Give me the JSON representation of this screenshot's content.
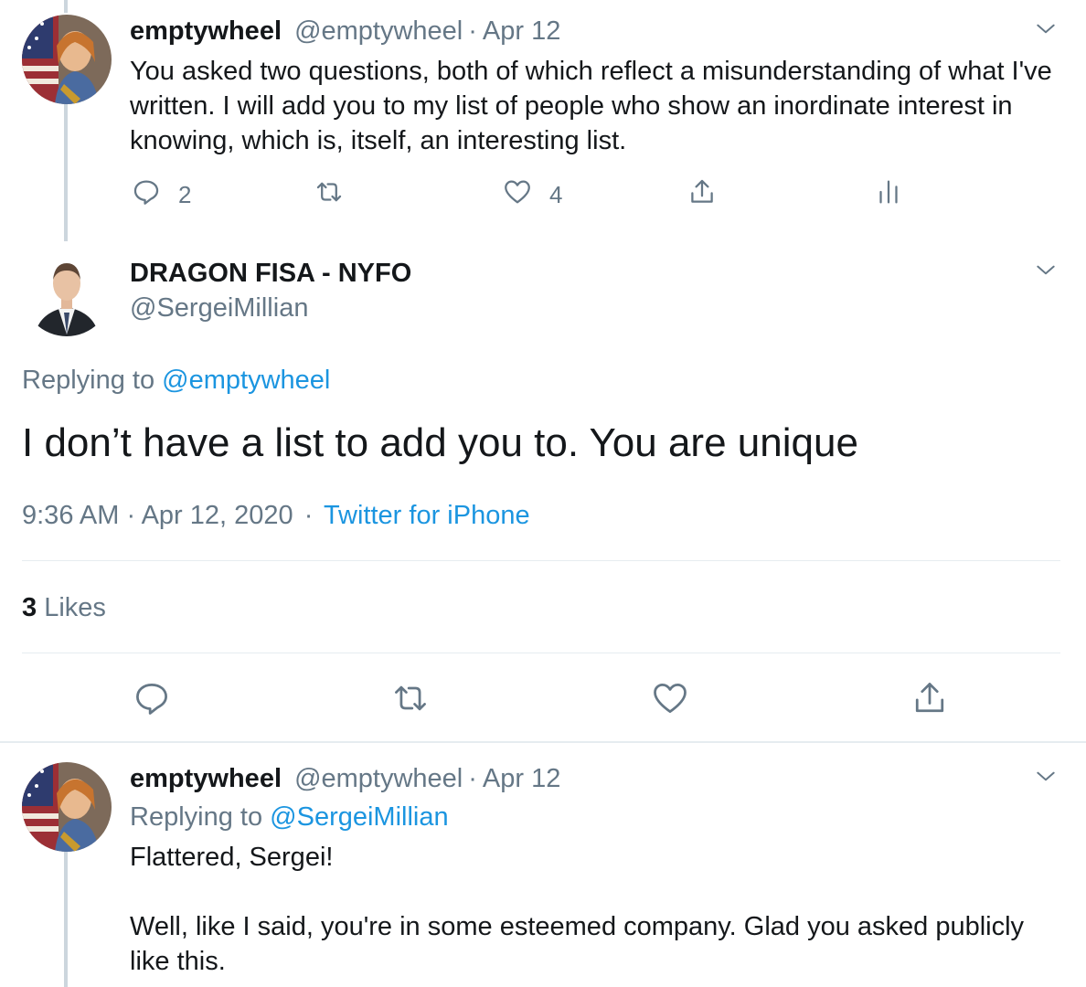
{
  "tweet1": {
    "name": "emptywheel",
    "handle": "@emptywheel",
    "separator": "·",
    "date": "Apr 12",
    "text": "You asked two questions, both of which reflect a misunderstanding of what I've written. I will add you to my list of people who show an inordinate interest in knowing, which is, itself, an interesting list.",
    "reply_count": "2",
    "like_count": "4"
  },
  "main_tweet": {
    "name": "DRAGON FISA - NYFO",
    "handle": "@SergeiMillian",
    "replying_label": "Replying to",
    "replying_handle": "@emptywheel",
    "text": "I don’t have a list to add you to. You are unique",
    "time": "9:36 AM · Apr 12, 2020",
    "separator": "·",
    "source": "Twitter for iPhone",
    "likes_count": "3",
    "likes_label": "Likes"
  },
  "tweet3": {
    "name": "emptywheel",
    "handle": "@emptywheel",
    "separator": "·",
    "date": "Apr 12",
    "replying_label": "Replying to",
    "replying_handle": "@SergeiMillian",
    "text_line1": "Flattered, Sergei!",
    "text_line2": "Well, like I said, you're in some esteemed company. Glad you asked publicly like this."
  },
  "colors": {
    "link": "#1b95e0",
    "muted": "#657786",
    "text": "#14171a",
    "divider": "#e6ecf0",
    "thread_line": "#ccd6dd"
  }
}
